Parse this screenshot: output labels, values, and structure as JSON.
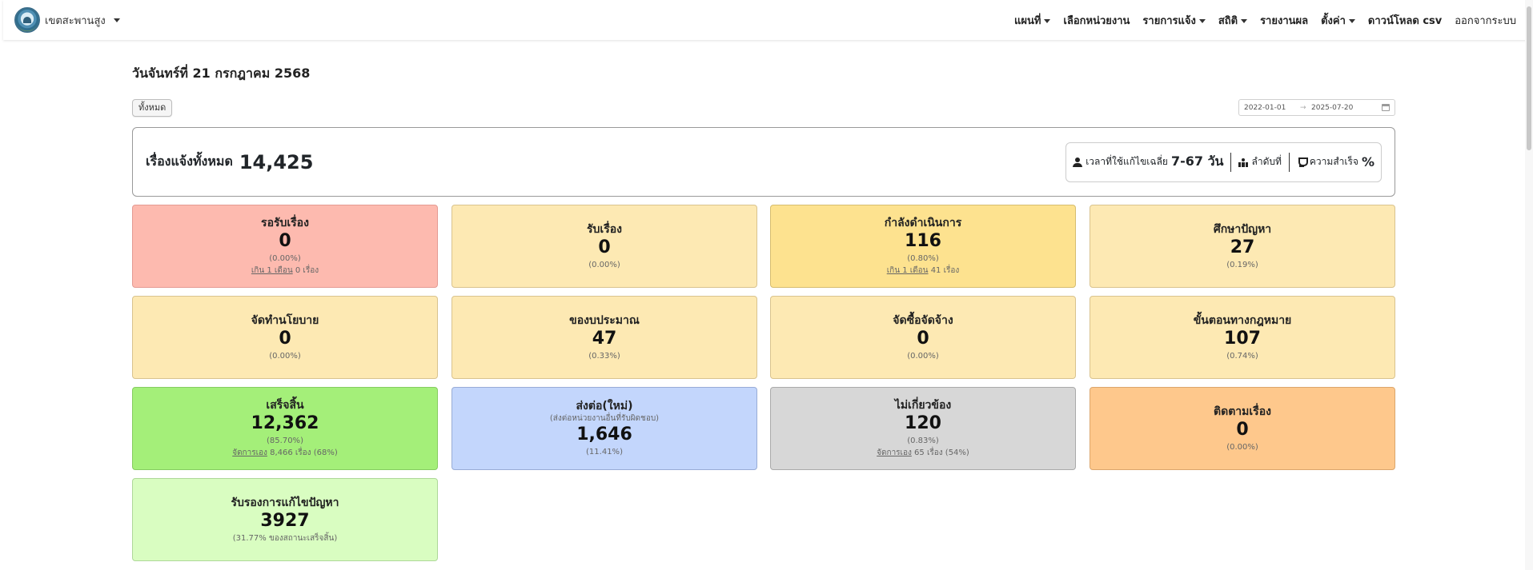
{
  "navbar": {
    "brand": "เขตสะพานสูง",
    "items": [
      {
        "label": "แผนที่",
        "dropdown": true
      },
      {
        "label": "เลือกหน่วยงาน",
        "dropdown": false
      },
      {
        "label": "รายการแจ้ง",
        "dropdown": true
      },
      {
        "label": "สถิติ",
        "dropdown": true
      },
      {
        "label": "รายงานผล",
        "dropdown": false
      },
      {
        "label": "ตั้งค่า",
        "dropdown": true
      },
      {
        "label": "ดาวน์โหลด csv",
        "dropdown": false
      },
      {
        "label": "ออกจากระบบ",
        "dropdown": false
      }
    ]
  },
  "date_heading": "วันจันทร์ที่ 21 กรกฎาคม 2568",
  "filter": {
    "all_button": "ทั้งหมด",
    "date_from": "2022-01-01",
    "date_to": "2025-07-20"
  },
  "summary": {
    "label": "เรื่องแจ้งทั้งหมด",
    "total": "14,425",
    "avg_time_label": "เวลาที่ใช้แก้ไขเฉลี่ย",
    "avg_time_value": "7-67 วัน",
    "rank_label": "ลำดับที่",
    "success_label": "ความสำเร็จ",
    "success_value": "%"
  },
  "cards": [
    {
      "title": "รอรับเรื่อง",
      "value": "0",
      "percent": "(0.00%)",
      "footer_link": "เกิน 1 เดือน",
      "footer_text": " 0 เรื่อง",
      "color": "#fdbaaf"
    },
    {
      "title": "รับเรื่อง",
      "value": "0",
      "percent": "(0.00%)",
      "color": "#fde9b3"
    },
    {
      "title": "กำลังดำเนินการ",
      "value": "116",
      "percent": "(0.80%)",
      "footer_link": "เกิน 1 เดือน",
      "footer_text": " 41 เรื่อง",
      "color": "#fde28f"
    },
    {
      "title": "ศึกษาปัญหา",
      "value": "27",
      "percent": "(0.19%)",
      "color": "#fde9b3"
    },
    {
      "title": "จัดทำนโยบาย",
      "value": "0",
      "percent": "(0.00%)",
      "color": "#fde9b3"
    },
    {
      "title": "ของบประมาณ",
      "value": "47",
      "percent": "(0.33%)",
      "color": "#fde9b3"
    },
    {
      "title": "จัดซื้อจัดจ้าง",
      "value": "0",
      "percent": "(0.00%)",
      "color": "#fde9b3"
    },
    {
      "title": "ขั้นตอนทางกฎหมาย",
      "value": "107",
      "percent": "(0.74%)",
      "color": "#fde9b3"
    },
    {
      "title": "เสร็จสิ้น",
      "value": "12,362",
      "percent": "(85.70%)",
      "footer_link": "จัดการเอง",
      "footer_text": " 8,466 เรื่อง (68%)",
      "color": "#a4ef79"
    },
    {
      "title": "ส่งต่อ(ใหม่)",
      "subtitle": "(ส่งต่อหน่วยงานอื่นที่รับผิดชอบ)",
      "value": "1,646",
      "percent": "(11.41%)",
      "color": "#c3d6fc"
    },
    {
      "title": "ไม่เกี่ยวข้อง",
      "value": "120",
      "percent": "(0.83%)",
      "footer_link": "จัดการเอง",
      "footer_text": " 65 เรื่อง (54%)",
      "color": "#d7d7d7"
    },
    {
      "title": "ติดตามเรื่อง",
      "value": "0",
      "percent": "(0.00%)",
      "color": "#fec88c"
    },
    {
      "title": "รับรองการแก้ไขปัญหา",
      "value": "3927",
      "percent": "(31.77% ของสถานะเสร็จสิ้น)",
      "color": "#d9fdc1"
    }
  ]
}
